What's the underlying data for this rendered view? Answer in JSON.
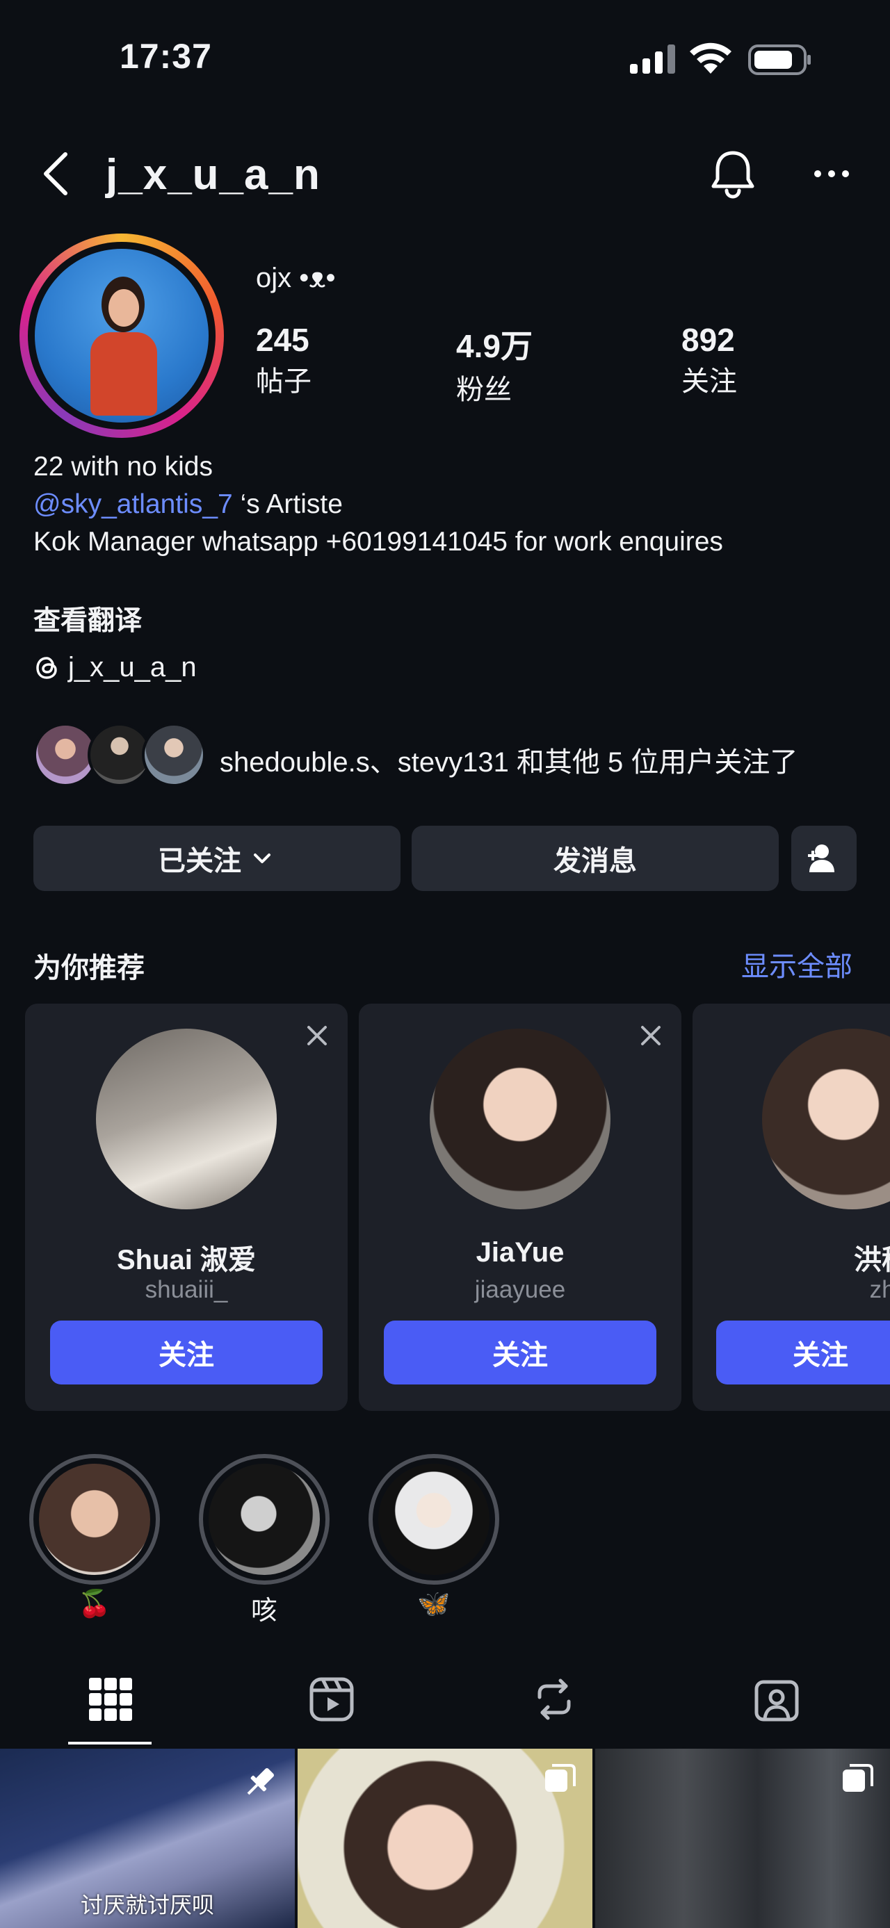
{
  "status_bar": {
    "time": "17:37"
  },
  "header": {
    "username": "j_x_u_a_n"
  },
  "profile": {
    "display_name": "ojx •ᴥ•",
    "stats": [
      {
        "value": "245",
        "label": "帖子"
      },
      {
        "value": "4.9万",
        "label": "粉丝"
      },
      {
        "value": "892",
        "label": "关注"
      }
    ],
    "bio_line1": "22 with no kids",
    "bio_mention": "@sky_atlantis_7",
    "bio_mention_suffix": " ‘s Artiste",
    "bio_line3": "Kok Manager whatsapp +60199141045 for work enquires",
    "see_translation": "查看翻译",
    "threads_handle": "j_x_u_a_n",
    "followed_by_text": "shedouble.s、stevy131 和其他 5 位用户关注了"
  },
  "actions": {
    "following_label": "已关注",
    "message_label": "发消息"
  },
  "suggested": {
    "title": "为你推荐",
    "show_all": "显示全部",
    "cards": [
      {
        "name": "Shuai 淑爱",
        "handle": "shuaiii_",
        "follow": "关注"
      },
      {
        "name": "JiaYue",
        "handle": "jiaayuee",
        "follow": "关注"
      },
      {
        "name": "洪稚柔",
        "handle": "zhiroub",
        "follow": "关注"
      }
    ]
  },
  "highlights": [
    {
      "label": "🍒"
    },
    {
      "label": "咳"
    },
    {
      "label": "🦋"
    }
  ],
  "grid": {
    "first_caption": "讨厌就讨厌呗"
  },
  "colors": {
    "background": "#0c0f14",
    "accent": "#4a5cf5",
    "link": "#6d8dff"
  }
}
